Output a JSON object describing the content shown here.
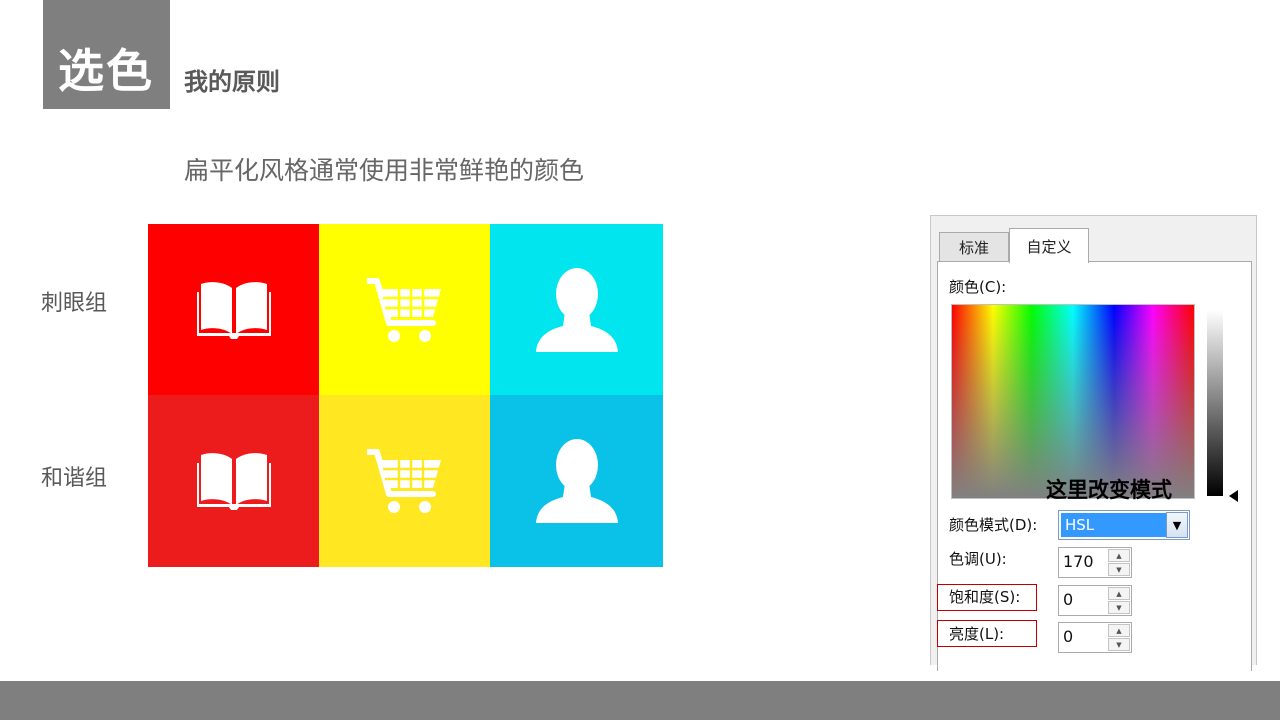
{
  "header": {
    "title": "选色",
    "subtitle": "我的原则"
  },
  "intro_text": "扁平化风格通常使用非常鲜艳的颜色",
  "groups": [
    {
      "label": "刺眼组",
      "tiles": [
        {
          "icon": "book-icon",
          "color": "#ff0000"
        },
        {
          "icon": "shopping-cart-icon",
          "color": "#ffff00"
        },
        {
          "icon": "user-icon",
          "color": "#00e5ee"
        }
      ]
    },
    {
      "label": "和谐组",
      "tiles": [
        {
          "icon": "book-icon",
          "color": "#ed1c1c"
        },
        {
          "icon": "shopping-cart-icon",
          "color": "#ffe821"
        },
        {
          "icon": "user-icon",
          "color": "#0ac2e8"
        }
      ]
    }
  ],
  "dialog": {
    "tabs": [
      "标准",
      "自定义"
    ],
    "active_tab": "自定义",
    "color_label": "颜色(C):",
    "mode_label": "颜色模式(D):",
    "mode_value": "HSL",
    "hue_label": "色调(U):",
    "hue_value": "170",
    "saturation_label": "饱和度(S):",
    "saturation_value": "0",
    "lightness_label": "亮度(L):",
    "lightness_value": "0"
  },
  "annotation": "这里改变模式"
}
